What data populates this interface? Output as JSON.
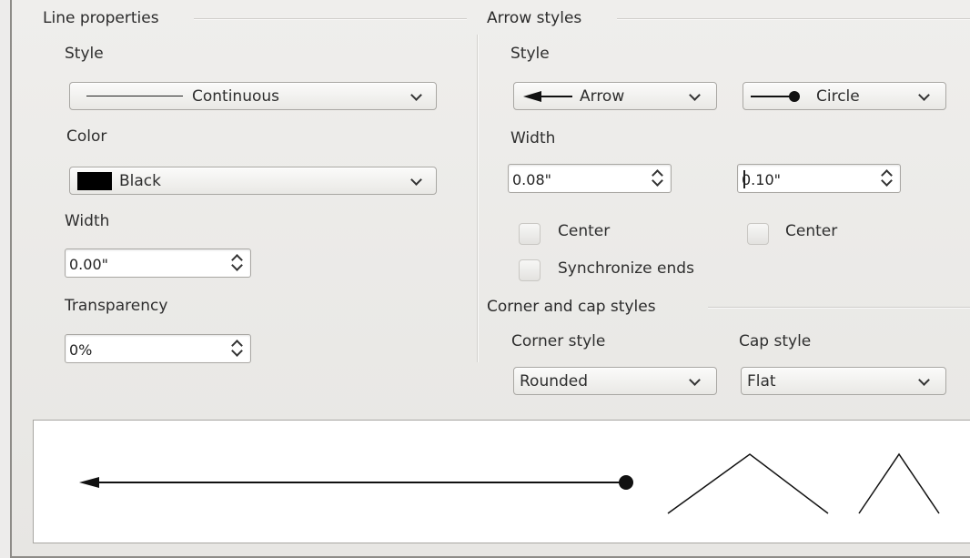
{
  "line_properties": {
    "title": "Line properties",
    "style_label": "Style",
    "style_value": "Continuous",
    "color_label": "Color",
    "color_value": "Black",
    "color_swatch": "#000000",
    "width_label": "Width",
    "width_value": "0.00\"",
    "transparency_label": "Transparency",
    "transparency_value": "0%"
  },
  "arrow_styles": {
    "title": "Arrow styles",
    "style_label": "Style",
    "start_style": "Arrow",
    "end_style": "Circle",
    "width_label": "Width",
    "start_width": "0.08\"",
    "end_width": "0.10\"",
    "center_start_label": "Center",
    "center_end_label": "Center",
    "sync_label": "Synchronize ends"
  },
  "corner_cap": {
    "title": "Corner and cap styles",
    "corner_label": "Corner style",
    "corner_value": "Rounded",
    "cap_label": "Cap style",
    "cap_value": "Flat"
  }
}
